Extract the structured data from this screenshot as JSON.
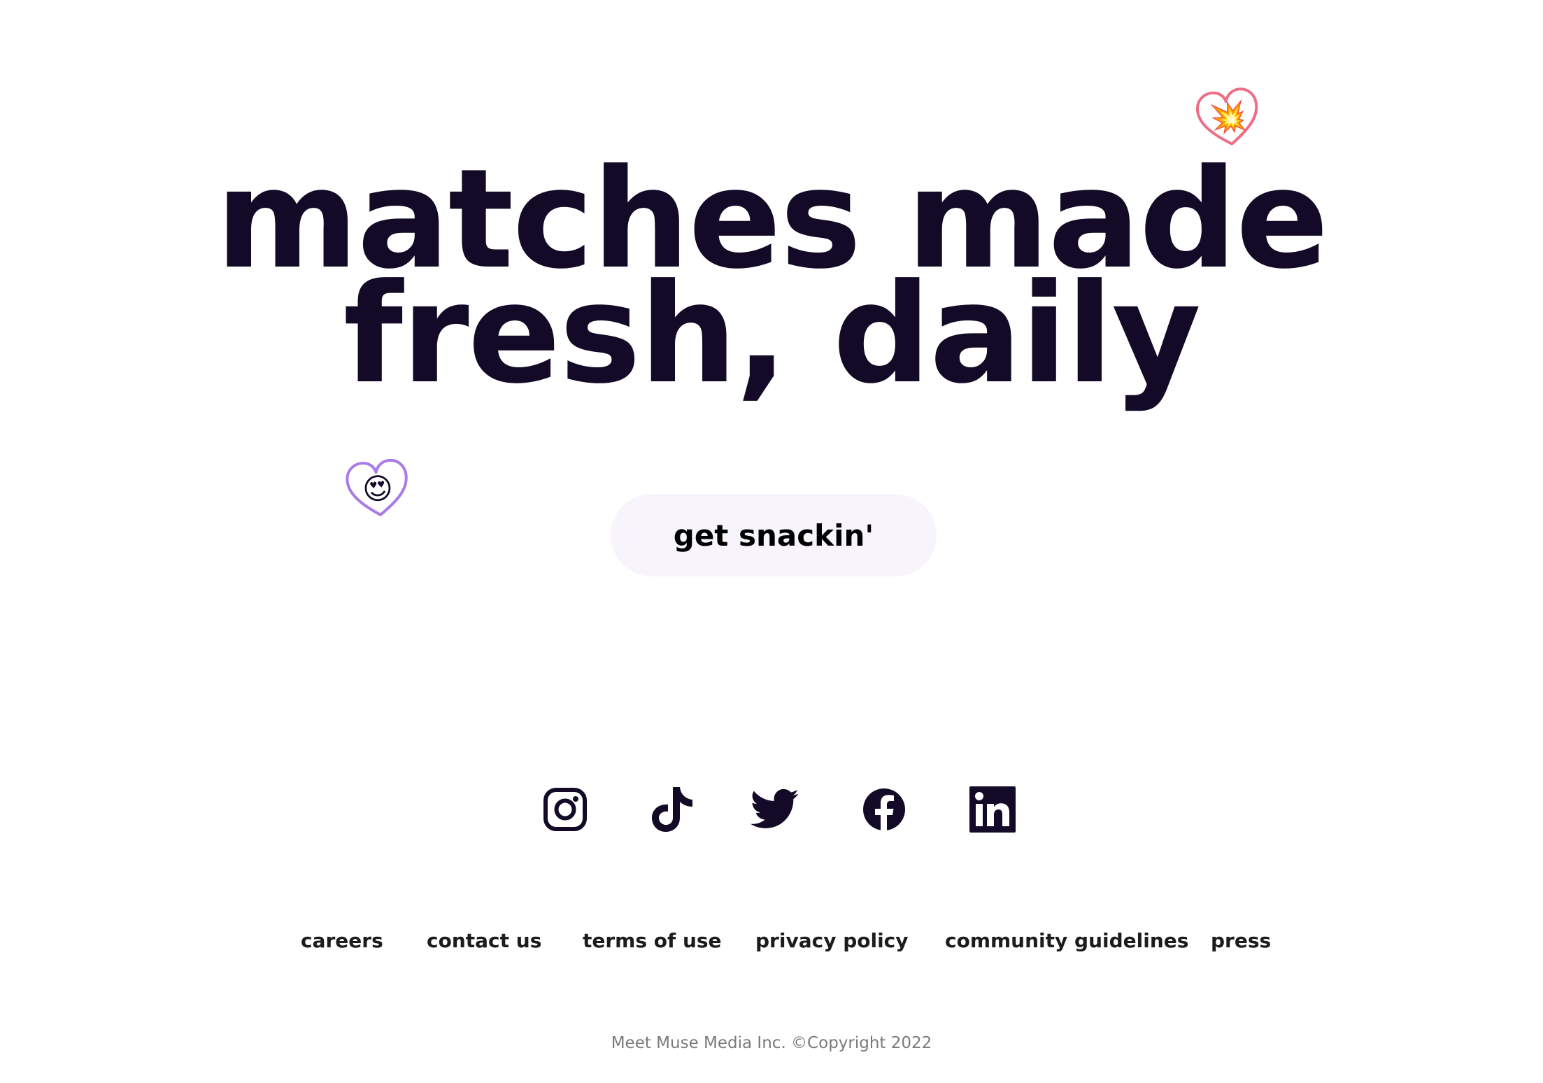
{
  "hero": {
    "line1": "matches made",
    "line2": "fresh, daily"
  },
  "stickers": {
    "top": {
      "emoji": "💥",
      "icon": "heart-outline-icon",
      "color": "#ec6f86"
    },
    "left": {
      "emoji": "😍",
      "icon": "heart-outline-icon",
      "color": "#a97be8"
    }
  },
  "cta": {
    "label": "get snackin'",
    "background": "#f8f4fc"
  },
  "social": [
    {
      "name": "instagram",
      "icon": "instagram-icon"
    },
    {
      "name": "tiktok",
      "icon": "tiktok-icon"
    },
    {
      "name": "twitter",
      "icon": "twitter-icon"
    },
    {
      "name": "facebook",
      "icon": "facebook-icon"
    },
    {
      "name": "linkedin",
      "icon": "linkedin-icon"
    }
  ],
  "footer": {
    "links": [
      "careers",
      "contact us",
      "terms of use",
      "privacy policy",
      "community guidelines",
      "press"
    ],
    "copyright": "Meet Muse Media Inc. ©Copyright 2022"
  },
  "colors": {
    "text": "#120a26",
    "footer_text": "#1c1c1c",
    "muted": "#7a7a7a"
  }
}
